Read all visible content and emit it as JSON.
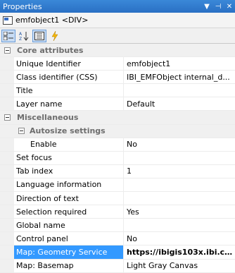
{
  "panel": {
    "title": "Properties"
  },
  "object": {
    "label": "emfobject1 <DIV>"
  },
  "toolbar": {
    "buttons": [
      {
        "name": "categorized-view",
        "icon": "categorized-icon"
      },
      {
        "name": "alphabetical-sort",
        "icon": "sort-az-icon"
      },
      {
        "name": "properties-view",
        "icon": "property-pages-icon"
      },
      {
        "name": "events-view",
        "icon": "lightning-icon"
      }
    ]
  },
  "grid": {
    "categories": {
      "core": "Core attributes",
      "misc": "Miscellaneous",
      "autosize": "Autosize settings"
    },
    "core_props": [
      {
        "name": "Unique Identifier",
        "value": "emfobject1"
      },
      {
        "name": "Class identifier (CSS)",
        "value": "IBI_EMFObject internal_d..."
      },
      {
        "name": "Title",
        "value": ""
      },
      {
        "name": "Layer name",
        "value": "Default"
      }
    ],
    "autosize_props": [
      {
        "name": "Enable",
        "value": "No"
      }
    ],
    "misc_props": [
      {
        "name": "Set focus",
        "value": ""
      },
      {
        "name": "Tab index",
        "value": "1"
      },
      {
        "name": "Language information",
        "value": ""
      },
      {
        "name": "Direction of text",
        "value": ""
      },
      {
        "name": "Selection required",
        "value": "Yes"
      },
      {
        "name": "Global name",
        "value": ""
      },
      {
        "name": "Control panel",
        "value": "No"
      },
      {
        "name": "Map: Geometry Service",
        "value": "https://ibigis103x.ibi.co..."
      },
      {
        "name": "Map: Basemap",
        "value": "Light Gray Canvas"
      }
    ]
  },
  "colors": {
    "titlebar": "#2a70c4",
    "selection": "#3399ff"
  }
}
